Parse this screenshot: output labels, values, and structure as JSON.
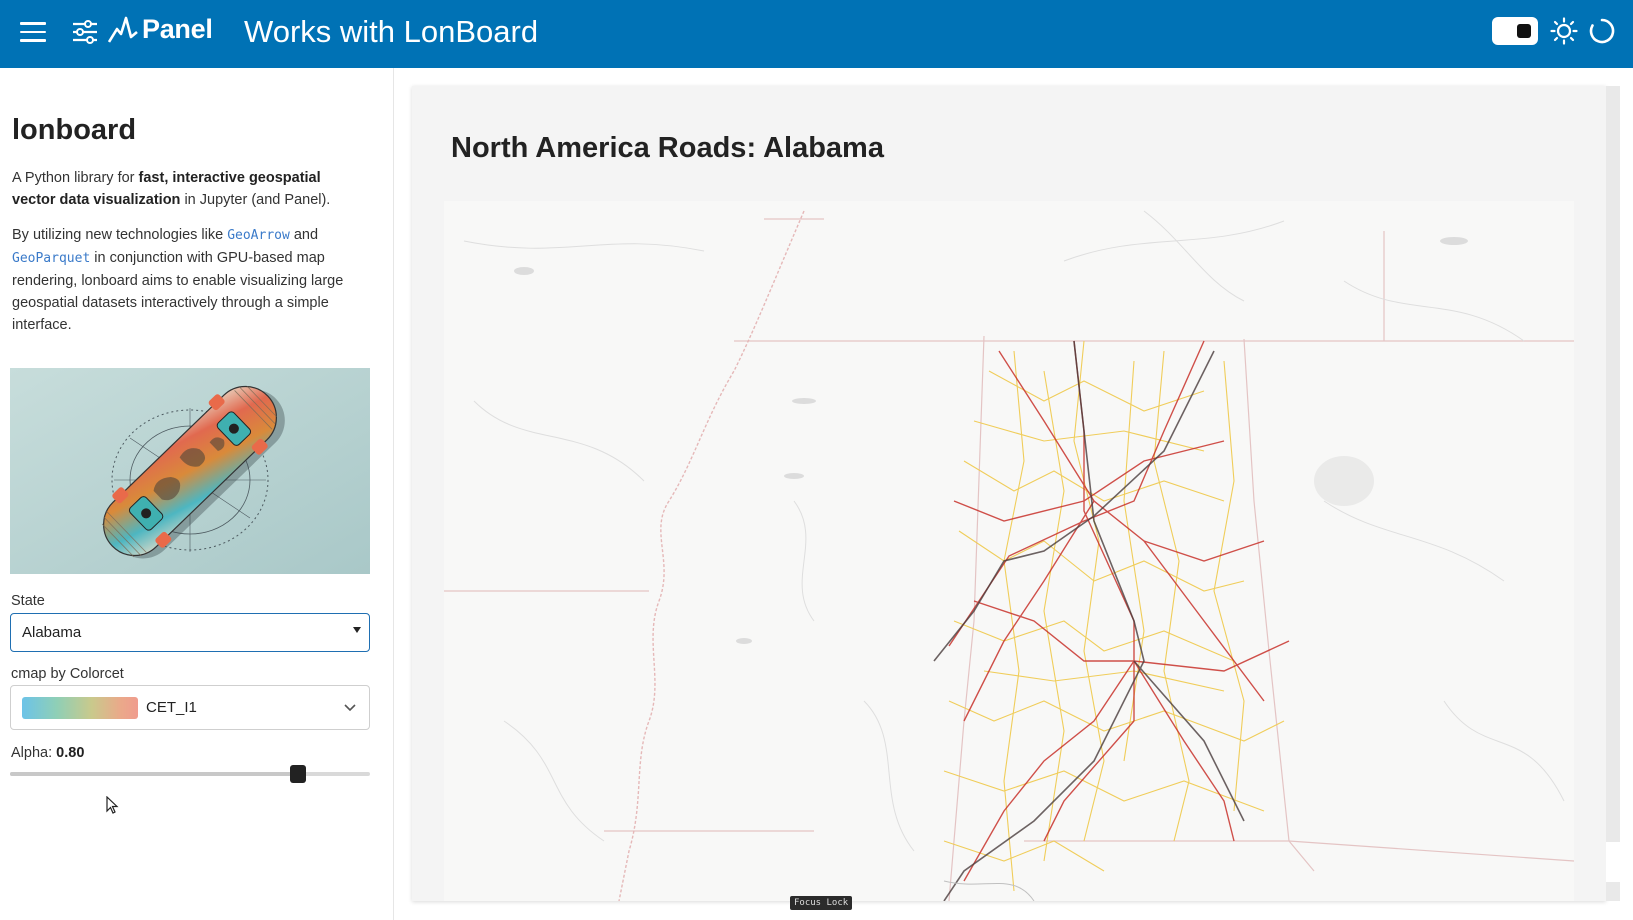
{
  "header": {
    "logo_text": "Panel",
    "title": "Works with LonBoard",
    "icons": [
      "hamburger-menu-icon",
      "settings-sliders-icon",
      "panel-logo-icon",
      "theme-toggle",
      "sun-icon",
      "loading-spinner-icon"
    ]
  },
  "sidebar": {
    "title": "lonboard",
    "desc1": {
      "pre": "A Python library for ",
      "bold": "fast, interactive geospatial vector data visualization",
      "post": " in Jupyter (and Panel)."
    },
    "desc2": {
      "pre": "By utilizing new technologies like ",
      "link1": "GeoArrow",
      "mid1": " and ",
      "link2": "GeoParquet",
      "post": " in conjunction with GPU-based map rendering, lonboard aims to enable visualizing large geospatial datasets interactively through a simple interface."
    },
    "state": {
      "label": "State",
      "value": "Alabama"
    },
    "cmap": {
      "label": "cmap by Colorcet",
      "value": "CET_I1"
    },
    "alpha": {
      "label": "Alpha: ",
      "value": "0.80",
      "fraction": 0.8
    }
  },
  "main": {
    "title": "North America Roads: Alabama"
  },
  "overlay": {
    "focus_lock": "Focus Lock"
  },
  "colors": {
    "header_bg": "#0072b5",
    "link": "#3a7ac9",
    "select_border": "#1f6fb2"
  }
}
